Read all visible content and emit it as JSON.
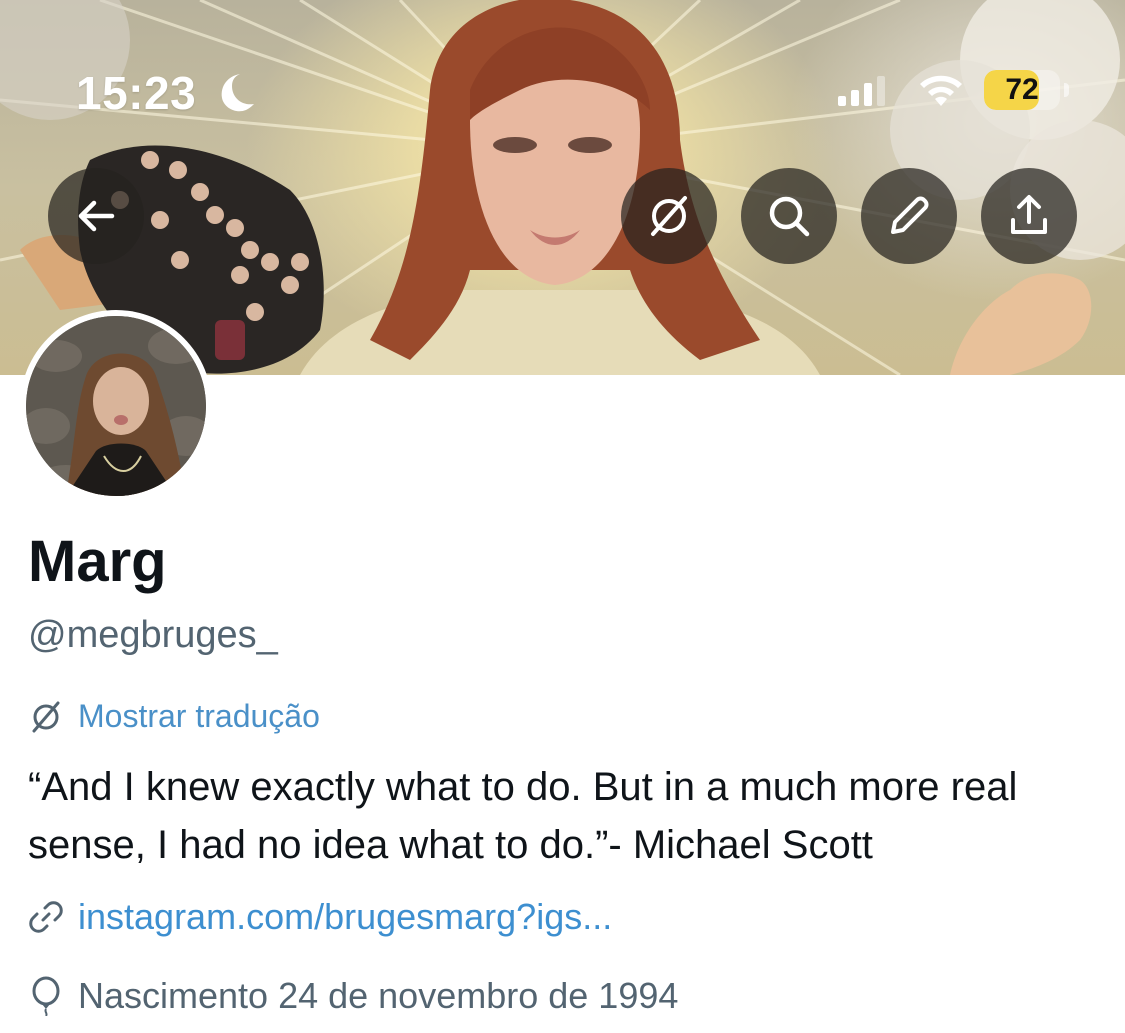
{
  "status_bar": {
    "time": "15:23",
    "battery_level": "72",
    "battery_fraction": 0.72
  },
  "header_actions": [
    {
      "name": "back",
      "icon": "arrow-left-icon"
    },
    {
      "name": "translate",
      "icon": "no-translate-icon"
    },
    {
      "name": "search",
      "icon": "search-icon"
    },
    {
      "name": "edit",
      "icon": "pencil-icon"
    },
    {
      "name": "share",
      "icon": "share-icon"
    }
  ],
  "profile": {
    "display_name": "Marg",
    "handle": "@megbruges_",
    "translate_label": "Mostrar tradução",
    "bio": "“And I knew exactly what to do. But in a much more real sense, I had no idea what to do.”- Michael Scott",
    "link": "instagram.com/brugesmarg?igs...",
    "birth": "Nascimento 24 de novembro de 1994"
  },
  "colors": {
    "link": "#3d8fd0",
    "secondary_text": "#536471",
    "primary_text": "#0f1419",
    "battery": "#f5d548"
  }
}
